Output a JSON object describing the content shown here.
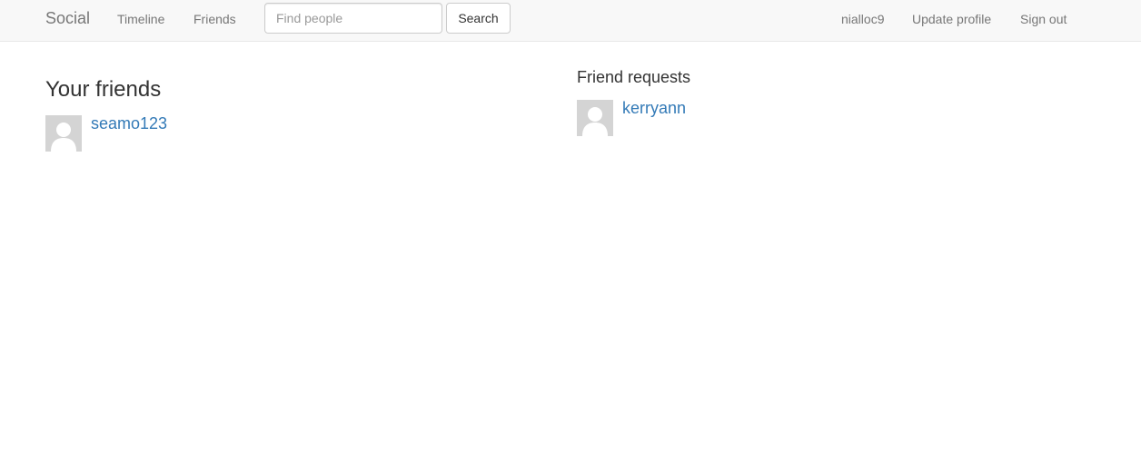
{
  "navbar": {
    "brand": "Social",
    "links": {
      "timeline": "Timeline",
      "friends": "Friends"
    },
    "search": {
      "placeholder": "Find people",
      "value": "",
      "button_label": "Search"
    },
    "right": {
      "username": "nialloc9",
      "update_profile": "Update profile",
      "sign_out": "Sign out"
    }
  },
  "friends": {
    "title": "Your friends",
    "items": [
      {
        "username": "seamo123",
        "avatar_icon": "default-user-avatar-icon"
      }
    ]
  },
  "requests": {
    "title": "Friend requests",
    "items": [
      {
        "username": "kerryann",
        "avatar_icon": "default-user-avatar-icon"
      }
    ]
  },
  "colors": {
    "navbar_bg": "#f8f8f8",
    "nav_text": "#777777",
    "link": "#337ab7",
    "avatar_bg": "#d4d4d4"
  }
}
